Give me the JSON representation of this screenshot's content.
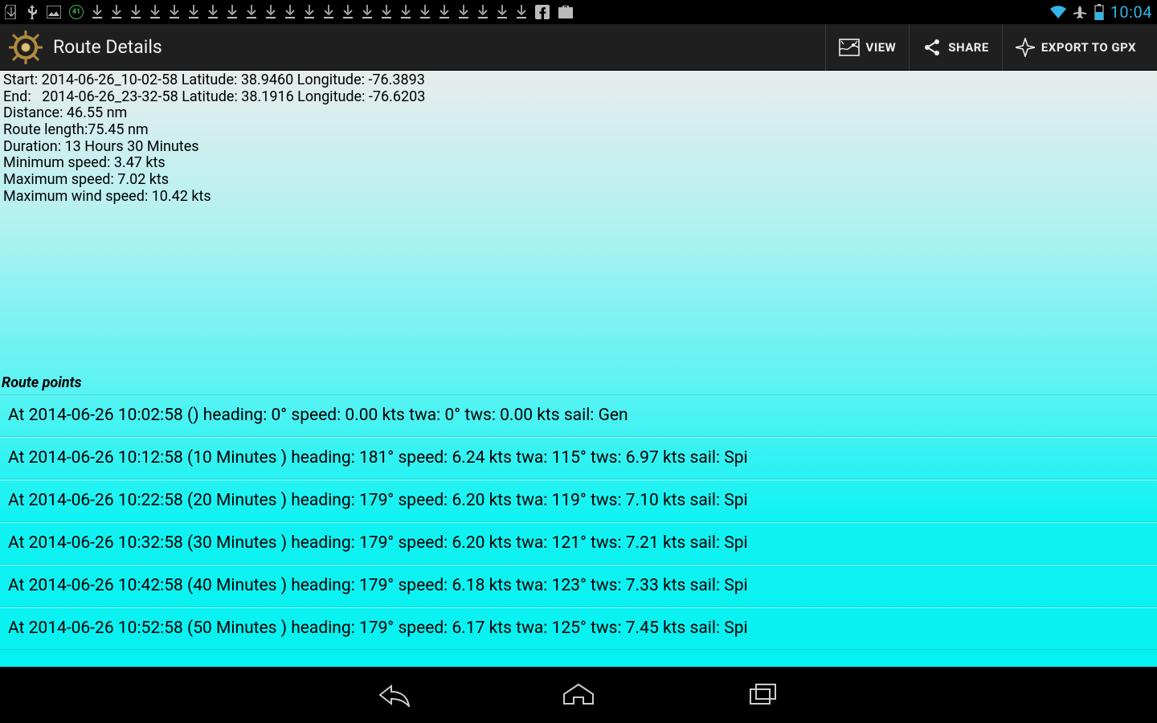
{
  "status": {
    "clock": "10:04",
    "download_icon_count": 23
  },
  "actionbar": {
    "title": "Route Details",
    "view_label": "VIEW",
    "share_label": "SHARE",
    "export_label": "EXPORT TO GPX"
  },
  "summary": {
    "start_line": "Start: 2014-06-26_10-02-58 Latitude: 38.9460 Longitude: -76.3893",
    "end_line": "End:   2014-06-26_23-32-58 Latitude: 38.1916 Longitude: -76.6203",
    "distance_line": "Distance: 46.55 nm",
    "route_length_line": "Route length:75.45 nm",
    "duration_line": "Duration: 13 Hours 30 Minutes",
    "min_speed_line": "Minimum speed: 3.47 kts",
    "max_speed_line": "Maximum speed: 7.02 kts",
    "max_wind_line": "Maximum wind speed: 10.42 kts"
  },
  "route_points_label": "Route points",
  "points": [
    "At 2014-06-26 10:02:58 () heading: 0° speed: 0.00 kts twa: 0° tws: 0.00 kts sail: Gen",
    "At 2014-06-26 10:12:58 (10 Minutes ) heading: 181° speed: 6.24 kts twa: 115° tws: 6.97 kts sail: Spi",
    "At 2014-06-26 10:22:58 (20 Minutes ) heading: 179° speed: 6.20 kts twa: 119° tws: 7.10 kts sail: Spi",
    "At 2014-06-26 10:32:58 (30 Minutes ) heading: 179° speed: 6.20 kts twa: 121° tws: 7.21 kts sail: Spi",
    "At 2014-06-26 10:42:58 (40 Minutes ) heading: 179° speed: 6.18 kts twa: 123° tws: 7.33 kts sail: Spi",
    "At 2014-06-26 10:52:58 (50 Minutes ) heading: 179° speed: 6.17 kts twa: 125° tws: 7.45 kts sail: Spi"
  ]
}
